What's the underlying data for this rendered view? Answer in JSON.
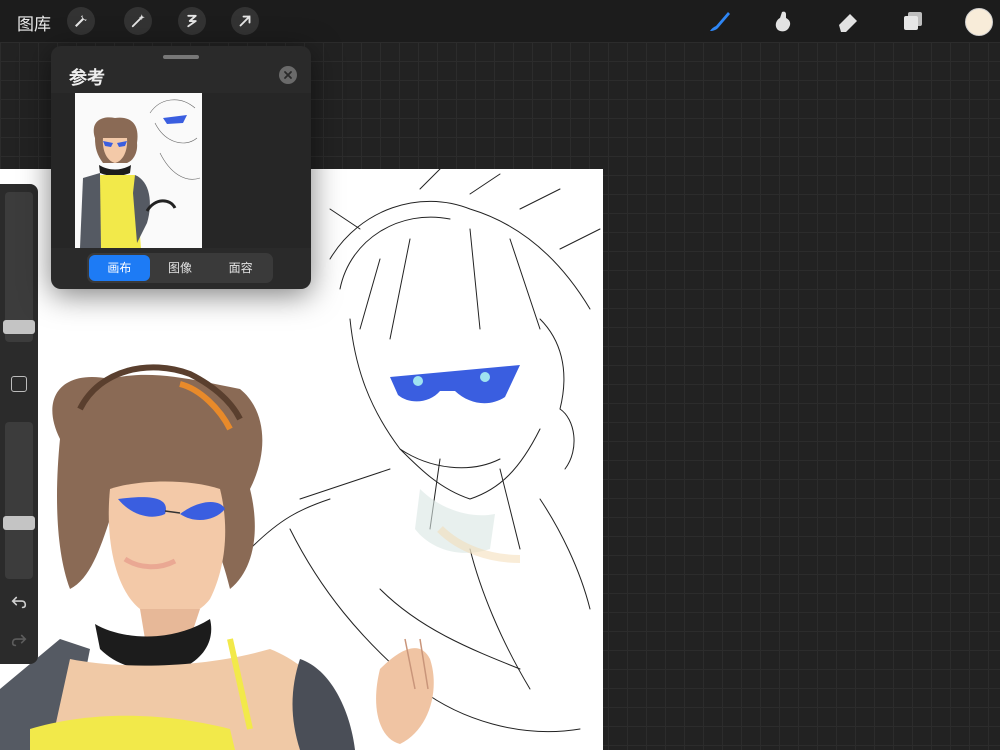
{
  "topbar": {
    "gallery_label": "图库",
    "left_tools": [
      "wrench-icon",
      "magic-wand-icon",
      "selection-icon",
      "transform-arrow-icon"
    ],
    "right_tools": [
      "brush-icon",
      "smudge-icon",
      "eraser-icon",
      "layers-icon"
    ],
    "current_color": "#f8ecd9"
  },
  "reference_panel": {
    "title": "参考",
    "segments": [
      {
        "label": "画布",
        "active": true
      },
      {
        "label": "图像",
        "active": false
      },
      {
        "label": "面容",
        "active": false
      }
    ]
  },
  "sidebar": {
    "brush_size_level": 0.88,
    "opacity_level": 0.65
  },
  "colors": {
    "accent": "#1d7bf5",
    "glasses_blue": "#3a5ee0",
    "shirt_yellow": "#f2e94a"
  }
}
